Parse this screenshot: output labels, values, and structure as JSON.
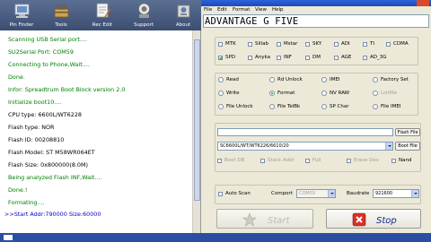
{
  "toolbar": {
    "buttons": [
      {
        "label": "Pin Finder"
      },
      {
        "label": "Tools"
      },
      {
        "label": "Rec Edit"
      },
      {
        "label": "Support"
      },
      {
        "label": "About"
      }
    ]
  },
  "log": {
    "lines": [
      {
        "text": "Scanning USB Serial port....",
        "color": "green"
      },
      {
        "text": "SU2Serial Port: COM59",
        "color": "green"
      },
      {
        "text": "Connecting to Phone,Wait....",
        "color": "green"
      },
      {
        "text": "Done.",
        "color": "green"
      },
      {
        "text": "Infor: Spreadtrum Boot Block version 2.0",
        "color": "green"
      },
      {
        "text": "Initialize boot10....",
        "color": "green"
      },
      {
        "text": "CPU    type: 6600L/WT6228",
        "color": "black"
      },
      {
        "text": "Flash  type: NOR",
        "color": "black"
      },
      {
        "text": "Flash     ID: 00208810",
        "color": "black"
      },
      {
        "text": "Flash Model: ST M58WR064ET",
        "color": "black"
      },
      {
        "text": "Flash Size: 0x800000(8.0M)",
        "color": "black"
      },
      {
        "text": "Being analyzed Flash INF,Wait....",
        "color": "green"
      },
      {
        "text": "Done.!",
        "color": "green"
      },
      {
        "text": "Formating....",
        "color": "green"
      },
      {
        "text": ">>Start Addr:790000 Size:60000",
        "color": "blue"
      }
    ]
  },
  "notepad": {
    "menu": [
      "File",
      "Edit",
      "Format",
      "View",
      "Help"
    ],
    "text": "ADVANTAGE G FIVE"
  },
  "models": {
    "row1": [
      {
        "label": "MTK",
        "checked": false
      },
      {
        "label": "Sillab",
        "checked": false
      },
      {
        "label": "Mstar",
        "checked": false
      },
      {
        "label": "SKY",
        "checked": false
      },
      {
        "label": "ADI",
        "checked": false
      },
      {
        "label": "TI",
        "checked": false
      },
      {
        "label": "CDMA",
        "checked": false
      }
    ],
    "row2": [
      {
        "label": "SPD",
        "checked": true
      },
      {
        "label": "Anyka",
        "checked": false
      },
      {
        "label": "INF",
        "checked": false
      },
      {
        "label": "DM",
        "checked": false
      },
      {
        "label": "AGE",
        "checked": false
      },
      {
        "label": "AD_3G",
        "checked": false
      }
    ]
  },
  "actions": {
    "col1": [
      {
        "label": "Read",
        "checked": false,
        "disabled": false
      },
      {
        "label": "Write",
        "checked": false,
        "disabled": false
      },
      {
        "label": "File Unlock",
        "checked": false,
        "disabled": false
      }
    ],
    "col2": [
      {
        "label": "Rd Unlock",
        "checked": false,
        "disabled": false
      },
      {
        "label": "Format",
        "checked": true,
        "disabled": false
      },
      {
        "label": "File TelBk",
        "checked": false,
        "disabled": false
      }
    ],
    "col3": [
      {
        "label": "IMEI",
        "checked": false,
        "disabled": false
      },
      {
        "label": "NV RAW",
        "checked": false,
        "disabled": false
      },
      {
        "label": "SP Char",
        "checked": false,
        "disabled": false
      }
    ],
    "col4": [
      {
        "label": "Factory Set",
        "checked": false,
        "disabled": false
      },
      {
        "label": "Listfile",
        "checked": false,
        "disabled": true
      },
      {
        "label": "File IMEI",
        "checked": false,
        "disabled": false
      }
    ]
  },
  "flash": {
    "path_value": "",
    "path_button": "Flash File",
    "cpu_value": "SC6600L/WT/WT6226/6610/20",
    "boot_button": "Boot File",
    "options": [
      {
        "label": "Boot DB",
        "disabled": true
      },
      {
        "label": "Stack Addr",
        "disabled": true
      },
      {
        "label": "Full",
        "disabled": true
      },
      {
        "label": "Erase Dev",
        "disabled": true
      },
      {
        "label": "Nand",
        "disabled": false
      }
    ]
  },
  "connection": {
    "auto_scan_label": "Auto Scan",
    "comport_label": "Comport",
    "comport_value": "COM59",
    "baudrate_label": "Baudrate",
    "baudrate_value": "921600"
  },
  "buttons": {
    "start": "Start",
    "stop": "Stop"
  }
}
